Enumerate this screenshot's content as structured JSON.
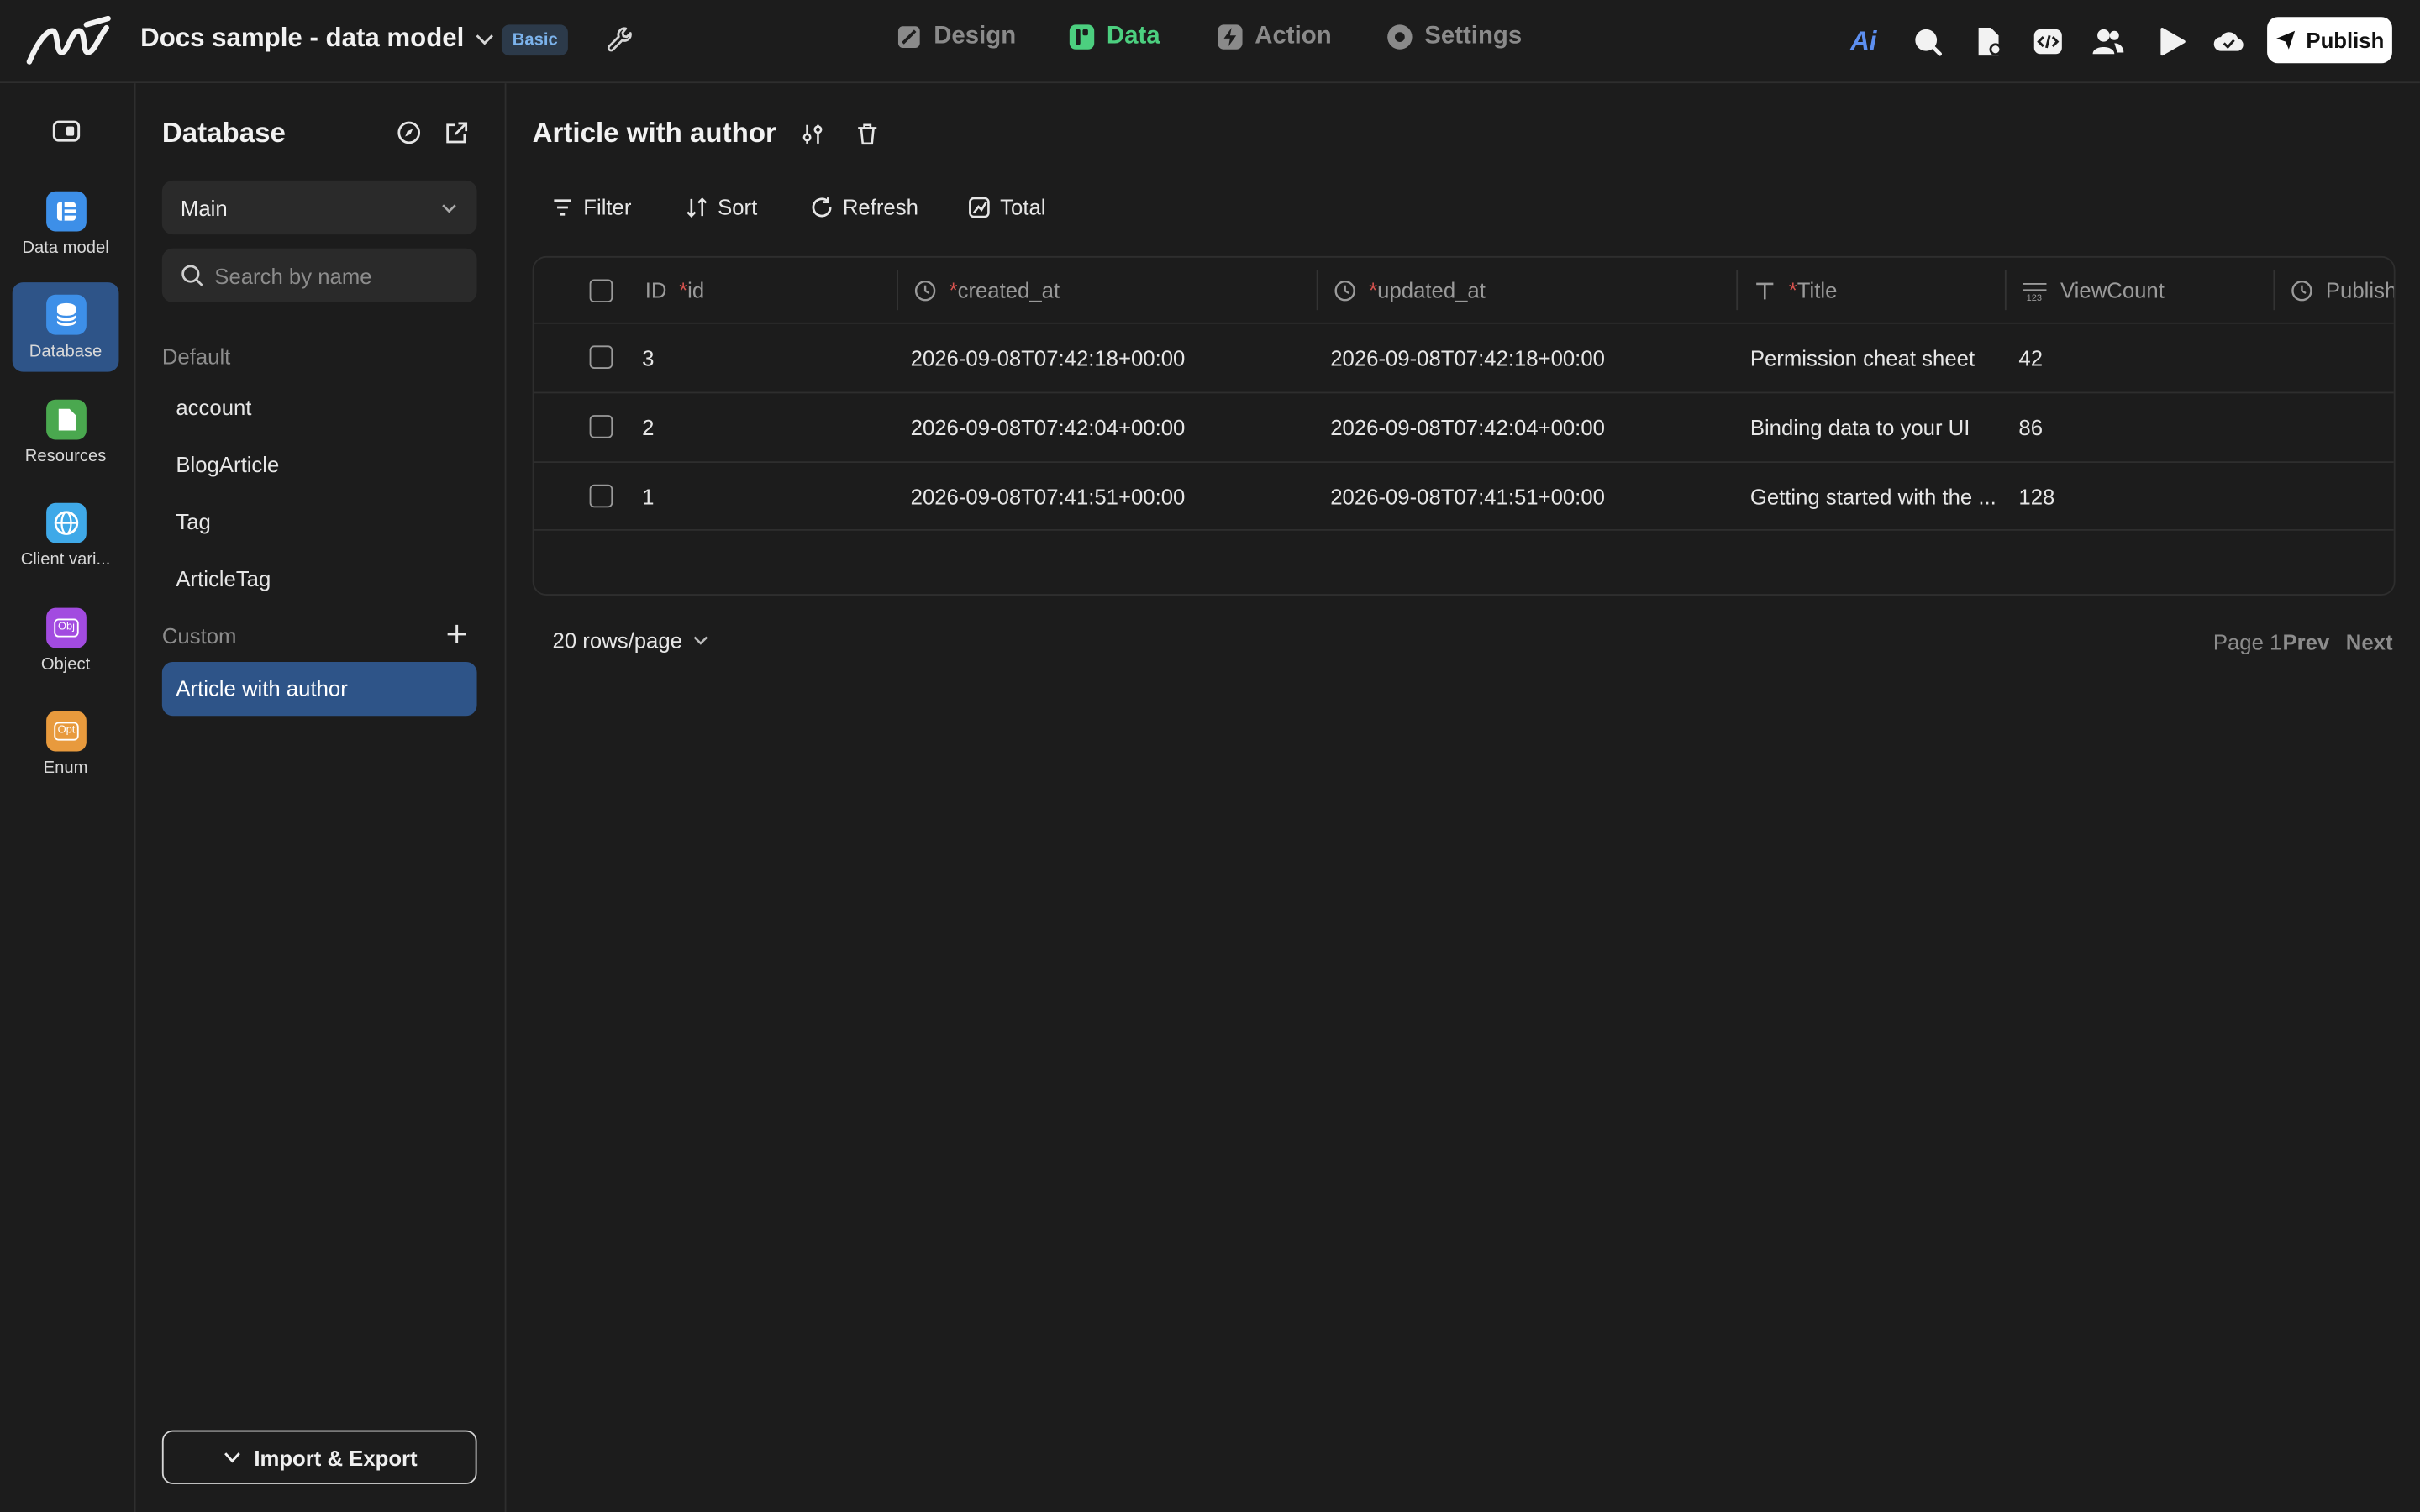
{
  "header": {
    "app_title": "Docs sample - data model",
    "plan_badge": "Basic",
    "nav_tabs": [
      {
        "label": "Design",
        "icon": "design-icon"
      },
      {
        "label": "Data",
        "icon": "data-icon",
        "active": true
      },
      {
        "label": "Action",
        "icon": "action-icon"
      },
      {
        "label": "Settings",
        "icon": "settings-icon"
      }
    ],
    "tools": [
      "ai-icon",
      "search-icon",
      "file-settings-icon",
      "code-icon",
      "users-icon",
      "play-icon",
      "cloud-icon"
    ],
    "ai_label": "Ai",
    "publish_label": "Publish"
  },
  "rail": {
    "items": [
      {
        "label": "Data model",
        "icon": "data-model-icon",
        "color": "#3d8fe8"
      },
      {
        "label": "Database",
        "icon": "database-icon",
        "color": "#3d8fe8",
        "active": true
      },
      {
        "label": "Resources",
        "icon": "resources-icon",
        "color": "#4aa84f"
      },
      {
        "label": "Client vari...",
        "icon": "globe-icon",
        "color": "#3fa9e8"
      },
      {
        "label": "Object",
        "icon": "object-icon",
        "color": "#a24be0",
        "badge": "Obj"
      },
      {
        "label": "Enum",
        "icon": "enum-icon",
        "color": "#e89a3d",
        "badge": "Opt"
      }
    ]
  },
  "db_panel": {
    "title": "Database",
    "selected_database": "Main",
    "search_placeholder": "Search by name",
    "default_label": "Default",
    "default_tables": [
      "account",
      "BlogArticle",
      "Tag",
      "ArticleTag"
    ],
    "custom_label": "Custom",
    "custom_views": [
      "Article with author"
    ],
    "import_export_label": "Import & Export"
  },
  "main": {
    "title": "Article with author",
    "toolbar": {
      "filter": "Filter",
      "sort": "Sort",
      "refresh": "Refresh",
      "total": "Total"
    },
    "columns": [
      {
        "type_label": "ID",
        "required": "*",
        "name": "id"
      },
      {
        "type_icon": "clock-icon",
        "required": "*",
        "name": "created_at"
      },
      {
        "type_icon": "clock-icon",
        "required": "*",
        "name": "updated_at"
      },
      {
        "type_icon": "text-icon",
        "required": "*",
        "name": "Title"
      },
      {
        "type_icon": "number-icon",
        "required": "",
        "name": "ViewCount"
      },
      {
        "type_icon": "clock-icon",
        "required": "",
        "name": "Publish"
      }
    ],
    "rows": [
      {
        "id": "3",
        "created_at": "2026-09-08T07:42:18+00:00",
        "updated_at": "2026-09-08T07:42:18+00:00",
        "title": "Permission cheat sheet",
        "view_count": "42"
      },
      {
        "id": "2",
        "created_at": "2026-09-08T07:42:04+00:00",
        "updated_at": "2026-09-08T07:42:04+00:00",
        "title": "Binding data to your UI",
        "view_count": "86"
      },
      {
        "id": "1",
        "created_at": "2026-09-08T07:41:51+00:00",
        "updated_at": "2026-09-08T07:41:51+00:00",
        "title": "Getting started with the ...",
        "view_count": "128"
      }
    ],
    "pagination": {
      "rows_per_page": "20 rows/page",
      "page": "Page 1",
      "prev": "Prev",
      "next": "Next"
    }
  }
}
